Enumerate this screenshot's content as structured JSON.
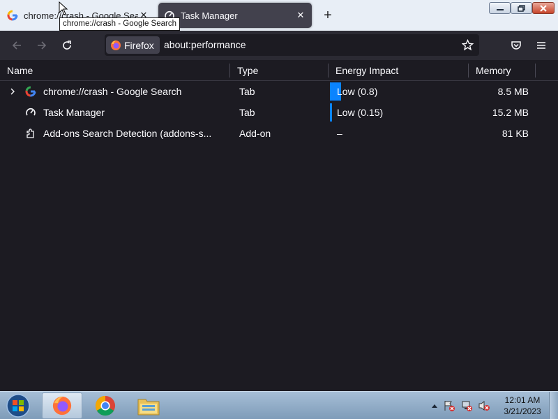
{
  "tabs": [
    {
      "title": "chrome://crash - Google Search",
      "icon": "google-icon",
      "active": false
    },
    {
      "title": "Task Manager",
      "icon": "gauge-icon",
      "active": true
    }
  ],
  "tooltip": "chrome://crash - Google Search",
  "urlbar": {
    "identity_label": "Firefox",
    "url": "about:performance"
  },
  "table": {
    "headers": [
      "Name",
      "Type",
      "Energy Impact",
      "Memory"
    ],
    "rows": [
      {
        "name": "chrome://crash - Google Search",
        "type": "Tab",
        "energy": "Low (0.8)",
        "energy_level": 0.8,
        "memory": "8.5 MB",
        "icon": "google-icon",
        "expandable": true
      },
      {
        "name": "Task Manager",
        "type": "Tab",
        "energy": "Low (0.15)",
        "energy_level": 0.15,
        "memory": "15.2 MB",
        "icon": "gauge-icon",
        "expandable": false
      },
      {
        "name": "Add-ons Search Detection (addons-s...",
        "type": "Add-on",
        "energy": "–",
        "memory": "81 KB",
        "icon": "puzzle-icon",
        "expandable": false
      }
    ]
  },
  "taskbar": {
    "clock_time": "12:01 AM",
    "clock_date": "3/21/2023"
  },
  "colors": {
    "accent": "#0a84ff",
    "background": "#1c1b22",
    "toolbar": "#2b2a33"
  }
}
